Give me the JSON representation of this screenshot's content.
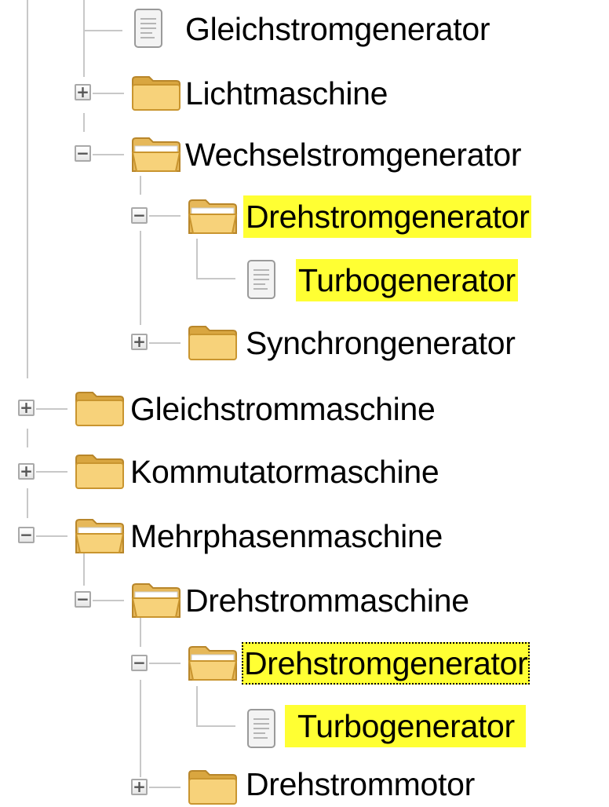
{
  "tree": {
    "items": [
      {
        "label": "Gleichstromgenerator",
        "toggle": "",
        "icon": "document-icon"
      },
      {
        "label": "Lichtmaschine",
        "toggle": "+",
        "icon": "folder-closed-icon"
      },
      {
        "label": "Wechselstromgenerator",
        "toggle": "−",
        "icon": "folder-open-icon"
      },
      {
        "label": "Drehstromgenerator",
        "toggle": "−",
        "icon": "folder-open-icon",
        "highlighted": true
      },
      {
        "label": "Turbogenerator",
        "toggle": "",
        "icon": "document-icon",
        "highlighted": true
      },
      {
        "label": "Synchrongenerator",
        "toggle": "+",
        "icon": "folder-closed-icon"
      },
      {
        "label": "Gleichstrommaschine",
        "toggle": "+",
        "icon": "folder-closed-icon"
      },
      {
        "label": "Kommutatormaschine",
        "toggle": "+",
        "icon": "folder-closed-icon"
      },
      {
        "label": "Mehrphasenmaschine",
        "toggle": "−",
        "icon": "folder-open-icon"
      },
      {
        "label": "Drehstrommaschine",
        "toggle": "−",
        "icon": "folder-open-icon"
      },
      {
        "label": "Drehstromgenerator",
        "toggle": "−",
        "icon": "folder-open-icon",
        "highlighted": true,
        "focused": true
      },
      {
        "label": "Turbogenerator",
        "toggle": "",
        "icon": "document-icon",
        "highlighted": true
      },
      {
        "label": "Drehstrommotor",
        "toggle": "+",
        "icon": "folder-closed-icon"
      }
    ]
  },
  "colors": {
    "highlight": "#ffff33",
    "folder": "#f7d27a",
    "tree_line": "#c8c8c8"
  }
}
